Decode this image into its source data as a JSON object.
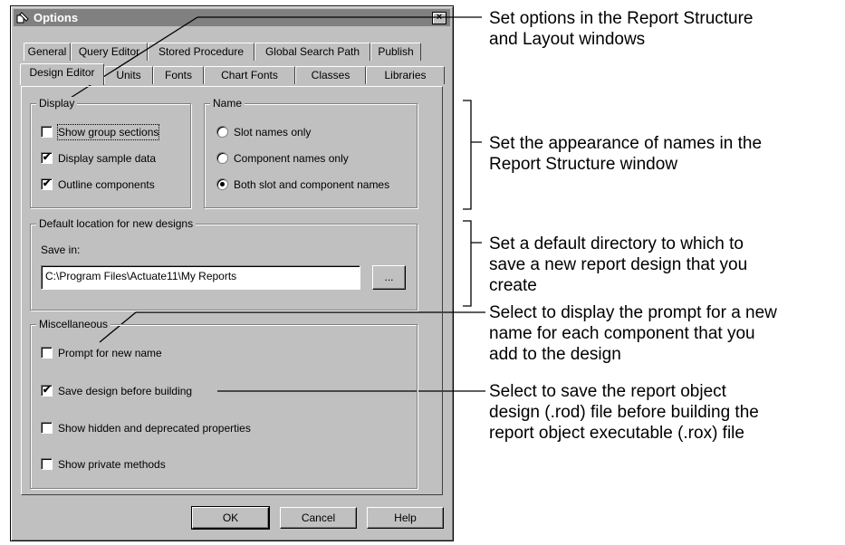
{
  "window": {
    "title": "Options",
    "tabs_row1": [
      "General",
      "Query Editor",
      "Stored Procedure",
      "Global Search Path",
      "Publish"
    ],
    "tabs_row2": [
      "Design Editor",
      "Units",
      "Fonts",
      "Chart Fonts",
      "Classes",
      "Libraries"
    ],
    "active_tab": "Design Editor"
  },
  "display": {
    "title": "Display",
    "items": [
      {
        "label": "Show group sections",
        "checked": false
      },
      {
        "label": "Display sample data",
        "checked": true
      },
      {
        "label": "Outline components",
        "checked": true
      }
    ]
  },
  "name": {
    "title": "Name",
    "options": [
      {
        "label": "Slot names only",
        "selected": false
      },
      {
        "label": "Component names only",
        "selected": false
      },
      {
        "label": "Both slot and component names",
        "selected": true
      }
    ]
  },
  "default_location": {
    "title": "Default location for new designs",
    "save_in_label": "Save in:",
    "path": "C:\\Program Files\\Actuate11\\My Reports",
    "browse_label": "..."
  },
  "misc": {
    "title": "Miscellaneous",
    "items": [
      {
        "label": "Prompt for new name",
        "checked": false
      },
      {
        "label": "Save design before building",
        "checked": true
      },
      {
        "label": "Show hidden and deprecated properties",
        "checked": false
      },
      {
        "label": "Show private methods",
        "checked": false
      }
    ]
  },
  "buttons": {
    "ok": "OK",
    "cancel": "Cancel",
    "help": "Help"
  },
  "annotations": {
    "a1": [
      "Set options in the Report Structure",
      "and Layout windows"
    ],
    "a2": [
      "Set the appearance of names in the",
      "Report Structure window"
    ],
    "a3": [
      "Set a default directory to which to",
      "save a new report design that you",
      "create"
    ],
    "a4": [
      "Select to display the prompt for a new",
      "name for each component that you",
      "add to the design"
    ],
    "a5": [
      "Select to save the report object",
      "design (.rod) file before building the",
      "report object executable (.rox) file"
    ]
  },
  "check_mark": "✔"
}
